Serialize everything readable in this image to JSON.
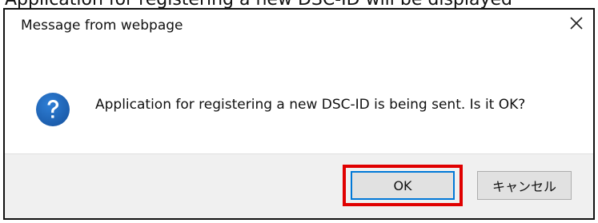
{
  "page_caption": "Application for registering a new DSC-ID will be displayed",
  "dialog": {
    "title": "Message from webpage",
    "message": "Application for registering a new DSC-ID is being sent.  Is it OK?",
    "ok_label": "OK",
    "cancel_label": "キャンセル",
    "highlight_color": "#e00000",
    "accent_color": "#0078d7",
    "icon": "question-icon"
  }
}
